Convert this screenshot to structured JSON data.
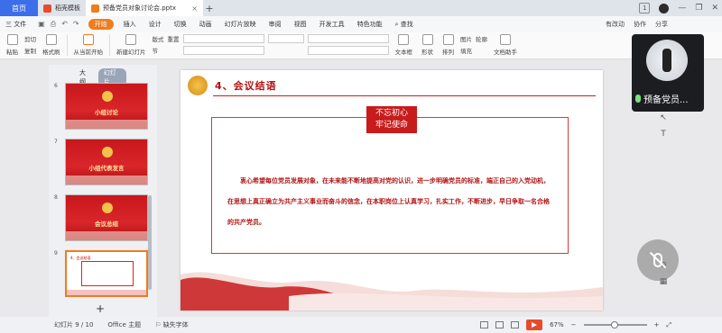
{
  "titlebar": {
    "home_tab": "首页",
    "tabs": [
      {
        "label": "稻壳模板",
        "icon": "docer-icon"
      },
      {
        "label": "预备党员对象讨论会.pptx",
        "icon": "ppt-file-icon"
      }
    ],
    "badge": "1"
  },
  "menu": {
    "file": "三 文件",
    "items": [
      "开始",
      "插入",
      "设计",
      "切换",
      "动画",
      "幻灯片放映",
      "审阅",
      "视图",
      "开发工具",
      "特色功能"
    ],
    "search": "查找",
    "right": [
      "有改动",
      "协作",
      "分享"
    ]
  },
  "ribbon": {
    "paste": "粘贴",
    "cut": "剪切",
    "copy": "复制",
    "format_painter": "格式刷",
    "from_current": "从当前开始",
    "new_slide": "新建幻灯片",
    "layout": "版式",
    "section": "节",
    "reset": "重置",
    "textbox": "文本框",
    "shape": "形状",
    "arrange": "排列",
    "image": "图片",
    "fill": "填充",
    "outline": "轮廓",
    "doc_assist": "文档助手"
  },
  "leftpanel": {
    "tabs": [
      "大纲",
      "幻灯片"
    ],
    "thumbs": [
      {
        "num": "6",
        "label": "小组讨论"
      },
      {
        "num": "7",
        "label": "小组代表发言"
      },
      {
        "num": "8",
        "label": "会议总结"
      },
      {
        "num": "9",
        "label": "4、会议结语"
      }
    ],
    "add": "+"
  },
  "slide": {
    "title": "4、会议结语",
    "label_line1": "不忘初心",
    "label_line2": "牢记使命",
    "body": "衷心希望每位党员发展对象，在未来能不断地提高对党的认识，进一步明确党员的标准，端正自己的入党动机，在思想上真正确立为共产主义事业而奋斗的信念，在本职岗位上认真学习，扎实工作，不断进步，早日争取一名合格的共产党员。"
  },
  "camera": {
    "name": "预备党员..."
  },
  "status": {
    "slide_counter": "幻灯片 9 / 10",
    "theme": "Office 主题",
    "missing_font": "缺失字体",
    "zoom": "67%"
  }
}
